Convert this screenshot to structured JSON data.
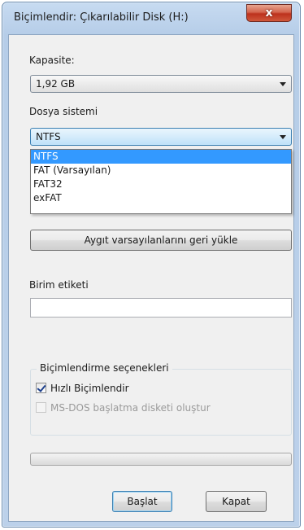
{
  "window": {
    "title": "Biçimlendir: Çıkarılabilir Disk (H:)",
    "close_label": "x"
  },
  "capacity": {
    "label": "Kapasite:",
    "value": "1,92 GB"
  },
  "filesystem": {
    "label": "Dosya sistemi",
    "value": "NTFS",
    "options": [
      "NTFS",
      "FAT (Varsayılan)",
      "FAT32",
      "exFAT"
    ],
    "selected_index": 0
  },
  "restore_defaults_label": "Aygıt varsayılanlarını geri yükle",
  "volume_label": {
    "label": "Birim etiketi",
    "value": ""
  },
  "format_options": {
    "title": "Biçimlendirme seçenekleri",
    "quick_format": {
      "label": "Hızlı Biçimlendir",
      "checked": true
    },
    "msdos_boot": {
      "label": "MS-DOS başlatma disketi oluştur",
      "checked": false,
      "enabled": false
    }
  },
  "progress": {
    "fraction": 0
  },
  "buttons": {
    "start": "Başlat",
    "close": "Kapat"
  }
}
